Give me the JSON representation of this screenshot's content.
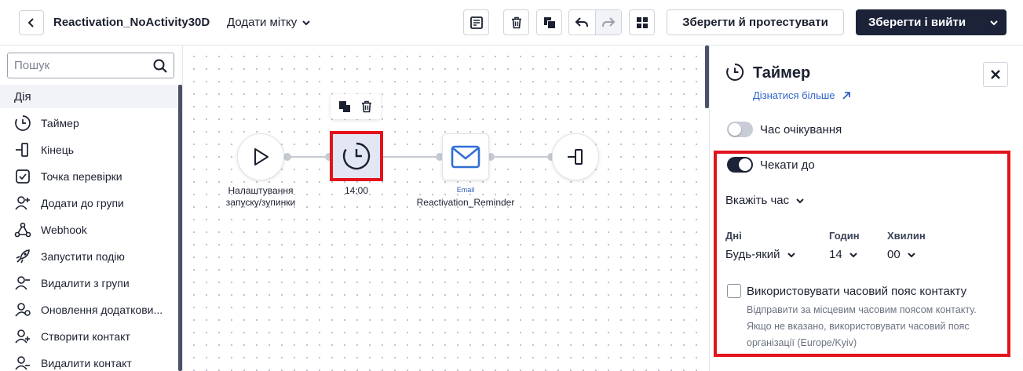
{
  "header": {
    "flow_title": "Reactivation_NoActivity30D",
    "add_tag_label": "Додати мітку",
    "save_test_label": "Зберегти й протестувати",
    "save_exit_label": "Зберегти і вийти"
  },
  "sidebar": {
    "search_placeholder": "Пошук",
    "section_label": "Дія",
    "items": [
      {
        "label": "Таймер",
        "icon": "timer-icon"
      },
      {
        "label": "Кінець",
        "icon": "end-icon"
      },
      {
        "label": "Точка перевірки",
        "icon": "checkpoint-icon"
      },
      {
        "label": "Додати до групи",
        "icon": "add-to-group-icon"
      },
      {
        "label": "Webhook",
        "icon": "webhook-icon"
      },
      {
        "label": "Запустити подію",
        "icon": "rocket-icon"
      },
      {
        "label": "Видалити з групи",
        "icon": "remove-from-group-icon"
      },
      {
        "label": "Оновлення додаткови...",
        "icon": "update-fields-icon"
      },
      {
        "label": "Створити контакт",
        "icon": "create-contact-icon"
      },
      {
        "label": "Видалити контакт",
        "icon": "delete-contact-icon"
      }
    ]
  },
  "canvas": {
    "start_node_label": "Налаштування запуску/зупинки",
    "timer_node_label": "14:00",
    "email_node_type": "Email",
    "email_node_label": "Reactivation_Reminder"
  },
  "panel": {
    "title": "Таймер",
    "learn_more": "Дізнатися більше",
    "wait_time_label": "Час очікування",
    "wait_until_label": "Чекати до",
    "specify_time_label": "Вкажіть час",
    "days_label": "Дні",
    "days_value": "Будь-який",
    "hours_label": "Годин",
    "hours_value": "14",
    "minutes_label": "Хвилин",
    "minutes_value": "00",
    "timezone_label": "Використовувати часовий пояс контакту",
    "timezone_help": "Відправити за місцевим часовим поясом контакту. Якщо не вказано, використовувати часовий пояс організації (Europe/Kyiv)",
    "wait_time_enabled": false,
    "wait_until_enabled": true,
    "timezone_checked": false
  },
  "colors": {
    "primary_dark": "#1c2238",
    "highlight_red": "#e3121b",
    "link_blue": "#2f64c8",
    "email_blue": "#2f6fd6"
  }
}
